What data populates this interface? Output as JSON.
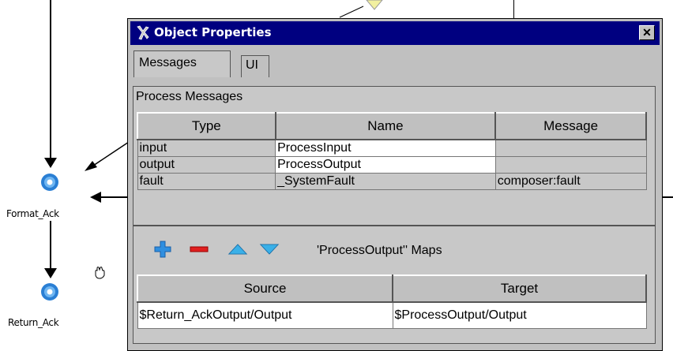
{
  "canvas": {
    "nodes": [
      {
        "label": "Format_Ack"
      },
      {
        "label": "Return_Ack"
      }
    ]
  },
  "dialog": {
    "title": "Object Properties",
    "close_label": "✕",
    "tabs": [
      {
        "label": "Messages",
        "active": true
      },
      {
        "label": "UI",
        "active": false
      }
    ],
    "process_messages": {
      "title": "Process Messages",
      "columns": [
        "Type",
        "Name",
        "Message"
      ],
      "rows": [
        {
          "type": "input",
          "name": "ProcessInput",
          "message": ""
        },
        {
          "type": "output",
          "name": "ProcessOutput",
          "message": ""
        },
        {
          "type": "fault",
          "name": "_SystemFault",
          "message": "composer:fault"
        }
      ]
    },
    "maps": {
      "toolbar": {
        "add_icon": "plus-icon",
        "remove_icon": "minus-icon",
        "up_icon": "arrow-up-icon",
        "down_icon": "arrow-down-icon"
      },
      "title": "'ProcessOutput'' Maps",
      "columns": [
        "Source",
        "Target"
      ],
      "rows": [
        {
          "source": "$Return_AckOutput/Output",
          "target": "$ProcessOutput/Output"
        }
      ]
    }
  },
  "colors": {
    "titlebar": "#000080",
    "dialog_bg": "#c0c0c0",
    "node_blue": "#2a7fd4"
  }
}
